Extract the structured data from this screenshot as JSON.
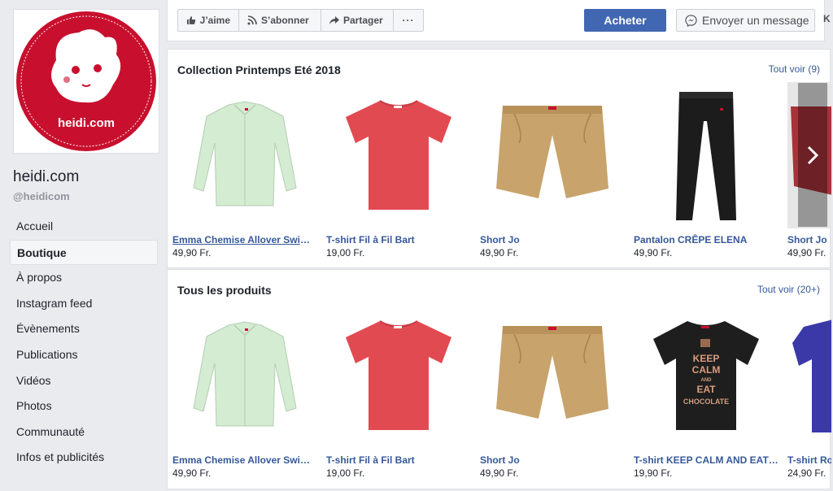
{
  "page": {
    "logo_text": "heidi.com",
    "name": "heidi.com",
    "handle": "@heidicom"
  },
  "nav": [
    {
      "label": "Accueil",
      "active": false
    },
    {
      "label": "Boutique",
      "active": true
    },
    {
      "label": "À propos",
      "active": false
    },
    {
      "label": "Instagram feed",
      "active": false
    },
    {
      "label": "Évènements",
      "active": false
    },
    {
      "label": "Publications",
      "active": false
    },
    {
      "label": "Vidéos",
      "active": false
    },
    {
      "label": "Photos",
      "active": false
    },
    {
      "label": "Communauté",
      "active": false
    },
    {
      "label": "Infos et publicités",
      "active": false
    }
  ],
  "actions": {
    "like": "J’aime",
    "follow": "S’abonner",
    "share": "Partager",
    "more": "···",
    "buy": "Acheter",
    "message": "Envoyer un message",
    "edge": "K"
  },
  "collection": {
    "title": "Collection Printemps Eté 2018",
    "see_all": "Tout voir (9)",
    "items": [
      {
        "name": "Emma Chemise Allover Swimmers",
        "price": "49,90 Fr.",
        "image": "shirt-mint"
      },
      {
        "name": "T-shirt Fil à Fil Bart",
        "price": "19,00 Fr.",
        "image": "tshirt-red"
      },
      {
        "name": "Short Jo",
        "price": "49,90 Fr.",
        "image": "shorts-khaki"
      },
      {
        "name": "Pantalon CRÊPE ELENA",
        "price": "49,90 Fr.",
        "image": "pants-black"
      },
      {
        "name": "Short Jo",
        "price": "49,90 Fr.",
        "image": "shorts-red"
      }
    ]
  },
  "all_products": {
    "title": "Tous les produits",
    "see_all": "Tout voir (20+)",
    "items": [
      {
        "name": "Emma Chemise Allover Swimmers",
        "price": "49,90 Fr.",
        "image": "shirt-mint"
      },
      {
        "name": "T-shirt Fil à Fil Bart",
        "price": "19,00 Fr.",
        "image": "tshirt-red"
      },
      {
        "name": "Short Jo",
        "price": "49,90 Fr.",
        "image": "shorts-khaki"
      },
      {
        "name": "T-shirt KEEP CALM AND EAT CHOCOLATE",
        "price": "19,90 Fr.",
        "image": "tshirt-black",
        "print_lines": [
          "KEEP",
          "CALM",
          "AND",
          "EAT",
          "CHOCOLATE"
        ]
      },
      {
        "name": "T-shirt Rob",
        "price": "24,90 Fr.",
        "image": "tshirt-blue"
      }
    ]
  },
  "colors": {
    "brand_red": "#c8102e",
    "link_blue": "#365899",
    "button_blue": "#4267b2"
  }
}
